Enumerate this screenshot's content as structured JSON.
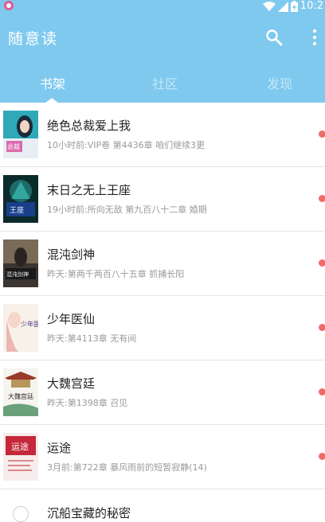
{
  "status_bar": {
    "time": "10:2",
    "app_icon": "pink-circle-app-icon",
    "icons": [
      "wifi-icon",
      "signal-icon",
      "battery-charging-icon"
    ]
  },
  "app_bar": {
    "title": "随意读",
    "search_icon": "search-icon",
    "more_icon": "more-vertical-icon"
  },
  "tabs": [
    {
      "label": "书架",
      "active": true
    },
    {
      "label": "社区",
      "active": false
    },
    {
      "label": "发现",
      "active": false
    }
  ],
  "books": [
    {
      "title": "绝色总裁爱上我",
      "meta": "10小时前:VIP卷 第4436章 咱们继续3更",
      "cover_caption": "总裁"
    },
    {
      "title": "末日之无上王座",
      "meta": "19小时前:所向无敌 第九百八十二章  婚期",
      "cover_caption": "王座"
    },
    {
      "title": "混沌剑神",
      "meta": "昨天:第两千两百八十五章 抓捕长阳",
      "cover_caption": "混沌剑神"
    },
    {
      "title": "少年医仙",
      "meta": "昨天:第4113章 无有间",
      "cover_caption": "少年医仙"
    },
    {
      "title": "大魏宫廷",
      "meta": "昨天:第1398章 召见",
      "cover_caption": "大魏宫廷"
    },
    {
      "title": "运途",
      "meta": "3月前:第722章 暴风雨前的短暂寂静(14)",
      "cover_caption": "运途"
    }
  ],
  "partial_item": {
    "title": "沉船宝藏的秘密"
  },
  "colors": {
    "header": "#7fc9ee",
    "unread_dot": "#f06a6a",
    "title_text": "#222222",
    "meta_text": "#9a9a9a"
  }
}
